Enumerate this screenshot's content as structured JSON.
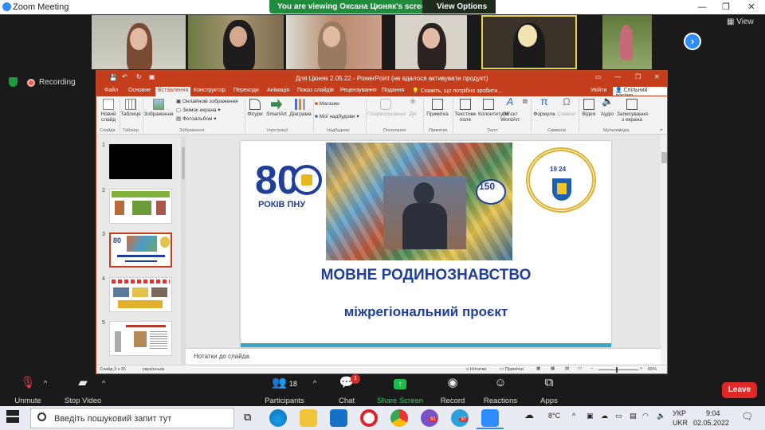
{
  "zoom": {
    "window_title": "Zoom Meeting",
    "banner_text": "You are viewing Оксана Цюняк's screen",
    "view_options": "View Options",
    "view_label": "View",
    "recording_label": "Recording"
  },
  "ppt": {
    "title": "Для Цюняк  2.05.22 - PowerPoint (не вдалося активувати продукт)",
    "signin": "Увійти",
    "share": "Спільний доступ",
    "tabs": [
      "Файл",
      "Основне",
      "Вставлення",
      "Конструктор",
      "Переходи",
      "Анімація",
      "Показ слайдів",
      "Рецензування",
      "Подання"
    ],
    "tell_me": "Скажіть, що потрібно зробити...",
    "ribbon": {
      "new_slide": "Новий слайд",
      "table": "Таблиця",
      "images": "Зображення",
      "online_images": "Онлайнові зображення",
      "screenshot": "Знімок екрана",
      "photo_album": "Фотоальбом",
      "shapes": "Фігури",
      "smartart": "SmartArt",
      "chart": "Діаграма",
      "store": "Магазин",
      "my_addins": "Мої надбудови",
      "hyperlink": "Гіперпосилання",
      "action": "Дія",
      "comment": "Примітка",
      "textbox": "Текстове поле",
      "header_footer": "Колонтитули",
      "wordart": "Об'єкт WordArt",
      "equation": "Формула",
      "symbol": "Символ",
      "video": "Відео",
      "audio": "Аудіо",
      "screen_record": "Записування з екрана",
      "groups": {
        "slides": "Слайди",
        "tables": "Таблиці",
        "images": "Зображення",
        "illustrations": "Ілюстрації",
        "addins": "Надбудови",
        "links": "Посилання",
        "comments": "Примітки",
        "text": "Текст",
        "symbols": "Символи",
        "media": "Мультимедіа"
      }
    },
    "slide_numbers": [
      "1",
      "2",
      "3",
      "4",
      "5"
    ],
    "slide": {
      "logo_number": "80",
      "logo_caption": "РОКІВ ПНУ",
      "badge_number": "150",
      "emblem_year": "19 24",
      "title": "МОВНЕ РОДИНОЗНАВСТВО",
      "subtitle": "міжрегіональний проєкт"
    },
    "notes_placeholder": "Нотатки до слайда",
    "status": {
      "slide_count": "Слайд 3 з 35",
      "language": "українська",
      "notes": "Нотатки",
      "comments": "Примітки",
      "zoom": "65%"
    },
    "accent_color": "#c43e1c"
  },
  "toolbar": {
    "unmute": "Unmute",
    "stop_video": "Stop Video",
    "participants": "Participants",
    "participants_count": "18",
    "chat": "Chat",
    "chat_badge": "1",
    "share_screen": "Share Screen",
    "record": "Record",
    "reactions": "Reactions",
    "apps": "Apps",
    "leave": "Leave"
  },
  "taskbar": {
    "search_placeholder": "Введіть пошуковий запит тут",
    "temperature": "8°C",
    "lang_top": "УКР",
    "lang_bottom": "UKR",
    "time": "9:04",
    "date": "02.05.2022",
    "viber_badge": "91",
    "telegram_badge": "30"
  }
}
